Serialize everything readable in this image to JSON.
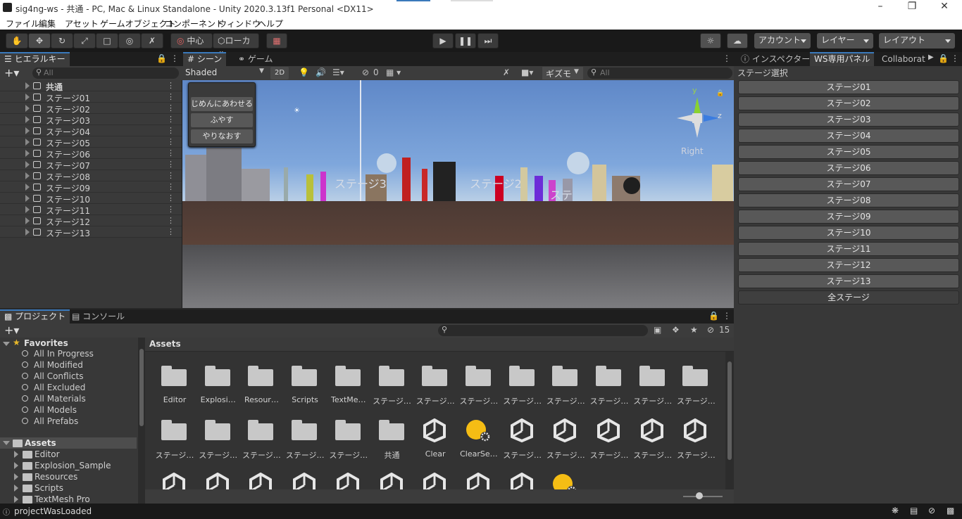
{
  "window": {
    "title": "sig4ng-ws - 共通 - PC, Mac & Linux Standalone - Unity 2020.3.13f1 Personal <DX11>"
  },
  "menu": [
    "ファイル",
    "編集",
    "アセット",
    "ゲームオブジェクト",
    "コンポーネント",
    "ウィンドウ",
    "ヘルプ"
  ],
  "toolbar": {
    "pivot": "中心",
    "space": "ローカル",
    "account": "アカウント",
    "layers": "レイヤー",
    "layout": "レイアウト"
  },
  "hierarchy": {
    "tab": "ヒエラルキー",
    "search_placeholder": "All",
    "items": [
      "共通",
      "ステージ01",
      "ステージ02",
      "ステージ03",
      "ステージ04",
      "ステージ05",
      "ステージ06",
      "ステージ07",
      "ステージ08",
      "ステージ09",
      "ステージ10",
      "ステージ11",
      "ステージ12",
      "ステージ13"
    ]
  },
  "scene": {
    "tabs": [
      "シーン",
      "ゲーム"
    ],
    "shading": "Shaded",
    "mode2d": "2D",
    "hidden_count": "0",
    "gizmos": "ギズモ",
    "search_placeholder": "All",
    "popup_buttons": [
      "じめんにあわせる",
      "ふやす",
      "やりなおす"
    ],
    "labels": [
      "ステージ3",
      "ステージ2",
      "ステ"
    ],
    "orient": "Right",
    "axis_y": "y",
    "axis_z": "z"
  },
  "inspector": {
    "tabs": [
      "インスペクター",
      "WS専用パネル",
      "Collaborat"
    ],
    "header": "ステージ選択",
    "buttons": [
      "ステージ01",
      "ステージ02",
      "ステージ03",
      "ステージ04",
      "ステージ05",
      "ステージ06",
      "ステージ07",
      "ステージ08",
      "ステージ09",
      "ステージ10",
      "ステージ11",
      "ステージ12",
      "ステージ13",
      "全ステージ"
    ]
  },
  "project": {
    "tabs": [
      "プロジェクト",
      "コンソール"
    ],
    "hidden_count": "15",
    "favorites_label": "Favorites",
    "favorites": [
      "All In Progress",
      "All Modified",
      "All Conflicts",
      "All Excluded",
      "All Materials",
      "All Models",
      "All Prefabs"
    ],
    "assets_label": "Assets",
    "tree": [
      "Editor",
      "Explosion_Sample",
      "Resources",
      "Scripts",
      "TextMesh Pro"
    ],
    "breadcrumb": "Assets",
    "grid": [
      {
        "label": "Editor",
        "kind": "folder"
      },
      {
        "label": "Explosi…",
        "kind": "folder"
      },
      {
        "label": "Resour…",
        "kind": "folder"
      },
      {
        "label": "Scripts",
        "kind": "folder"
      },
      {
        "label": "TextMe…",
        "kind": "folder"
      },
      {
        "label": "ステージ…",
        "kind": "folder"
      },
      {
        "label": "ステージ…",
        "kind": "folder"
      },
      {
        "label": "ステージ…",
        "kind": "folder"
      },
      {
        "label": "ステージ…",
        "kind": "folder"
      },
      {
        "label": "ステージ…",
        "kind": "folder"
      },
      {
        "label": "ステージ…",
        "kind": "folder"
      },
      {
        "label": "ステージ…",
        "kind": "folder"
      },
      {
        "label": "ステージ…",
        "kind": "folder"
      },
      {
        "label": "ステージ…",
        "kind": "folder"
      },
      {
        "label": "ステージ…",
        "kind": "folder"
      },
      {
        "label": "ステージ…",
        "kind": "folder"
      },
      {
        "label": "ステージ…",
        "kind": "folder"
      },
      {
        "label": "ステージ…",
        "kind": "folder"
      },
      {
        "label": "共通",
        "kind": "folder"
      },
      {
        "label": "Clear",
        "kind": "unity"
      },
      {
        "label": "ClearSe…",
        "kind": "settings"
      },
      {
        "label": "ステージ…",
        "kind": "unity"
      },
      {
        "label": "ステージ…",
        "kind": "unity"
      },
      {
        "label": "ステージ…",
        "kind": "unity"
      },
      {
        "label": "ステージ…",
        "kind": "unity"
      },
      {
        "label": "ステージ…",
        "kind": "unity"
      },
      {
        "label": "",
        "kind": "unity"
      },
      {
        "label": "",
        "kind": "unity"
      },
      {
        "label": "",
        "kind": "unity"
      },
      {
        "label": "",
        "kind": "unity"
      },
      {
        "label": "",
        "kind": "unity"
      },
      {
        "label": "",
        "kind": "unity"
      },
      {
        "label": "",
        "kind": "unity"
      },
      {
        "label": "",
        "kind": "unity"
      },
      {
        "label": "",
        "kind": "unity"
      },
      {
        "label": "",
        "kind": "settings"
      }
    ]
  },
  "status": {
    "message": "projectWasLoaded"
  },
  "colors": {
    "accent": "#3a79bb",
    "panel": "#383838",
    "toolbar": "#191919",
    "button": "#585858"
  }
}
